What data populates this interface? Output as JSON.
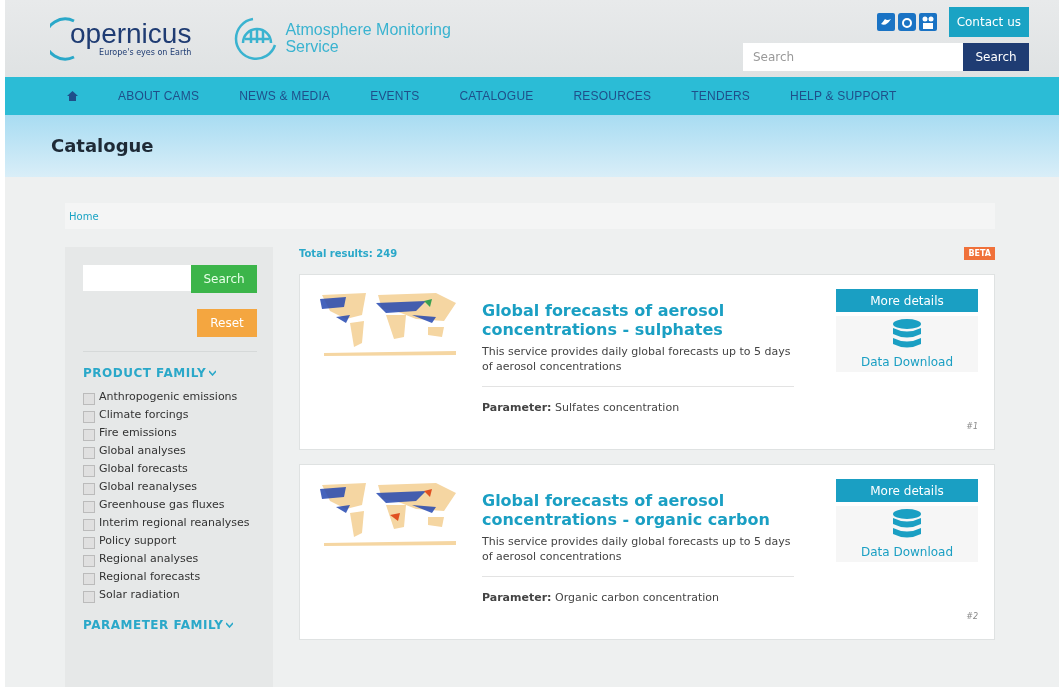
{
  "header": {
    "logo_text": "opernicus",
    "logo_tagline": "Europe's eyes on Earth",
    "service_name": [
      "Atmosphere Monitoring",
      "Service"
    ],
    "contact_button": "Contact us",
    "search": {
      "placeholder": "Search",
      "button": "Search"
    }
  },
  "nav": {
    "items": [
      {
        "label": "ABOUT CAMS",
        "selected": false
      },
      {
        "label": "NEWS & MEDIA",
        "selected": false
      },
      {
        "label": "EVENTS",
        "selected": false
      },
      {
        "label": "CATALOGUE",
        "selected": false
      },
      {
        "label": "RESOURCES",
        "selected": false
      },
      {
        "label": "TENDERS",
        "selected": false
      },
      {
        "label": "HELP & SUPPORT",
        "selected": false
      }
    ]
  },
  "page_title": "Catalogue",
  "breadcrumb": [
    "Home"
  ],
  "sidebar": {
    "search_button": "Search",
    "reset_button": "Reset",
    "sections": [
      {
        "title": "PRODUCT FAMILY",
        "expanded": true,
        "items": [
          {
            "label": "Anthropogenic emissions",
            "checked": false
          },
          {
            "label": "Climate forcings",
            "checked": false
          },
          {
            "label": "Fire emissions",
            "checked": false
          },
          {
            "label": "Global analyses",
            "checked": false
          },
          {
            "label": "Global forecasts",
            "checked": false
          },
          {
            "label": "Global reanalyses",
            "checked": false
          },
          {
            "label": "Greenhouse gas fluxes",
            "checked": false
          },
          {
            "label": "Interim regional reanalyses",
            "checked": false
          },
          {
            "label": "Policy support",
            "checked": false
          },
          {
            "label": "Regional analyses",
            "checked": false
          },
          {
            "label": "Regional forecasts",
            "checked": false
          },
          {
            "label": "Solar radiation",
            "checked": false
          }
        ]
      },
      {
        "title": "PARAMETER FAMILY",
        "expanded": true
      }
    ]
  },
  "results": {
    "total": "Total results: 249",
    "badge": "BETA",
    "items": [
      {
        "kind": "picture",
        "title": "Global forecasts of aerosol concentrations - sulphates",
        "description": "This service provides daily global forecasts up to 5 days of aerosol concentrations",
        "parameter_label": "Parameter:",
        "parameter": "Sulfates concentration",
        "details_button": "More details",
        "download": "Data Download",
        "index": "#1"
      },
      {
        "kind": "picture",
        "title": "Global forecasts of aerosol concentrations - organic carbon",
        "description": "This service provides daily global forecasts up to 5 days of aerosol concentrations",
        "parameter_label": "Parameter:",
        "parameter": "Organic carbon concentration",
        "details_button": "More details",
        "download": "Data Download",
        "index": "#2"
      }
    ]
  }
}
